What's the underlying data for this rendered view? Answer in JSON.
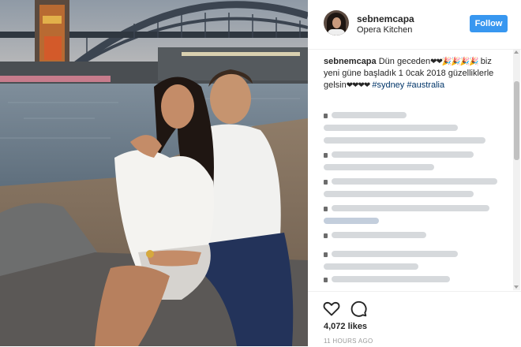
{
  "post": {
    "username": "sebnemcapa",
    "location": "Opera Kitchen",
    "follow_label": "Follow",
    "caption": {
      "username": "sebnemcapa",
      "text_1": "Dün geceden",
      "emoji_1": "❤❤🎉🎉🎉🎉",
      "text_2": "biz yeni güne başladık 1 0cak 2018 güzelliklerle gelsin",
      "emoji_2": "❤❤❤❤",
      "hashtag_1": "#sydney",
      "hashtag_2": "#australia"
    },
    "likes": "4,072 likes",
    "time": "11 HOURS AGO"
  },
  "icons": {
    "like": "heart-outline-icon",
    "comment": "speech-bubble-icon"
  },
  "colors": {
    "follow_button": "#3897f0",
    "hashtag": "#003569",
    "text": "#262626",
    "muted": "#999999"
  }
}
